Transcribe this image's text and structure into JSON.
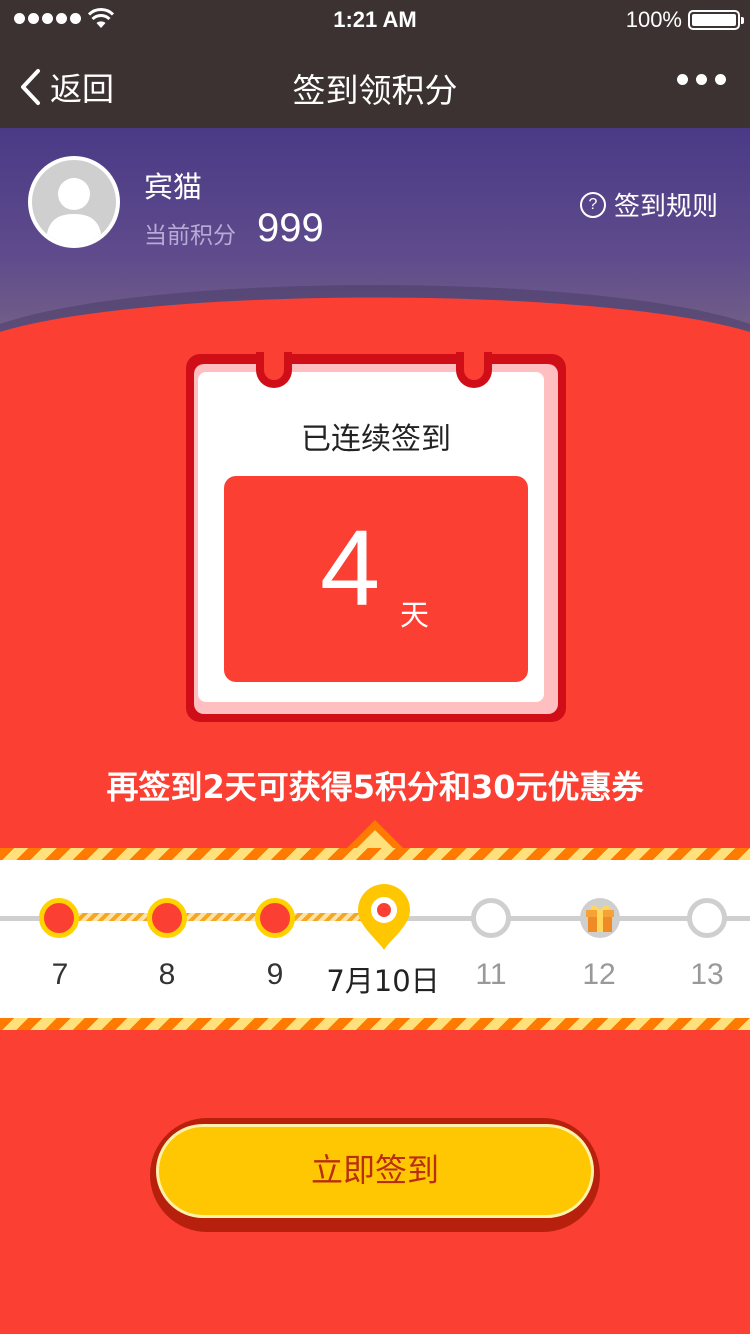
{
  "status_bar": {
    "time": "1:21 AM",
    "battery": "100%"
  },
  "nav": {
    "back_label": "返回",
    "title": "签到领积分"
  },
  "user": {
    "name": "宾猫",
    "points_label": "当前积分",
    "points": "999"
  },
  "rules_label": "签到规则",
  "calendar": {
    "title": "已连续签到",
    "days": "4",
    "unit": "天"
  },
  "promo_text": "再签到2天可获得5积分和30元优惠券",
  "timeline": {
    "days": [
      {
        "label": "7",
        "state": "signed"
      },
      {
        "label": "8",
        "state": "signed"
      },
      {
        "label": "9",
        "state": "signed"
      },
      {
        "label": "7月10日",
        "state": "today"
      },
      {
        "label": "11",
        "state": "future"
      },
      {
        "label": "12",
        "state": "gift"
      },
      {
        "label": "13",
        "state": "future"
      }
    ]
  },
  "sign_button_label": "立即签到",
  "colors": {
    "primary_red": "#fb3f33",
    "dark_red": "#d00e18",
    "accent_yellow": "#ffd200",
    "button_yellow": "#ffc702",
    "header_purple": "#4a3a86",
    "nav_dark": "#3d3232"
  }
}
